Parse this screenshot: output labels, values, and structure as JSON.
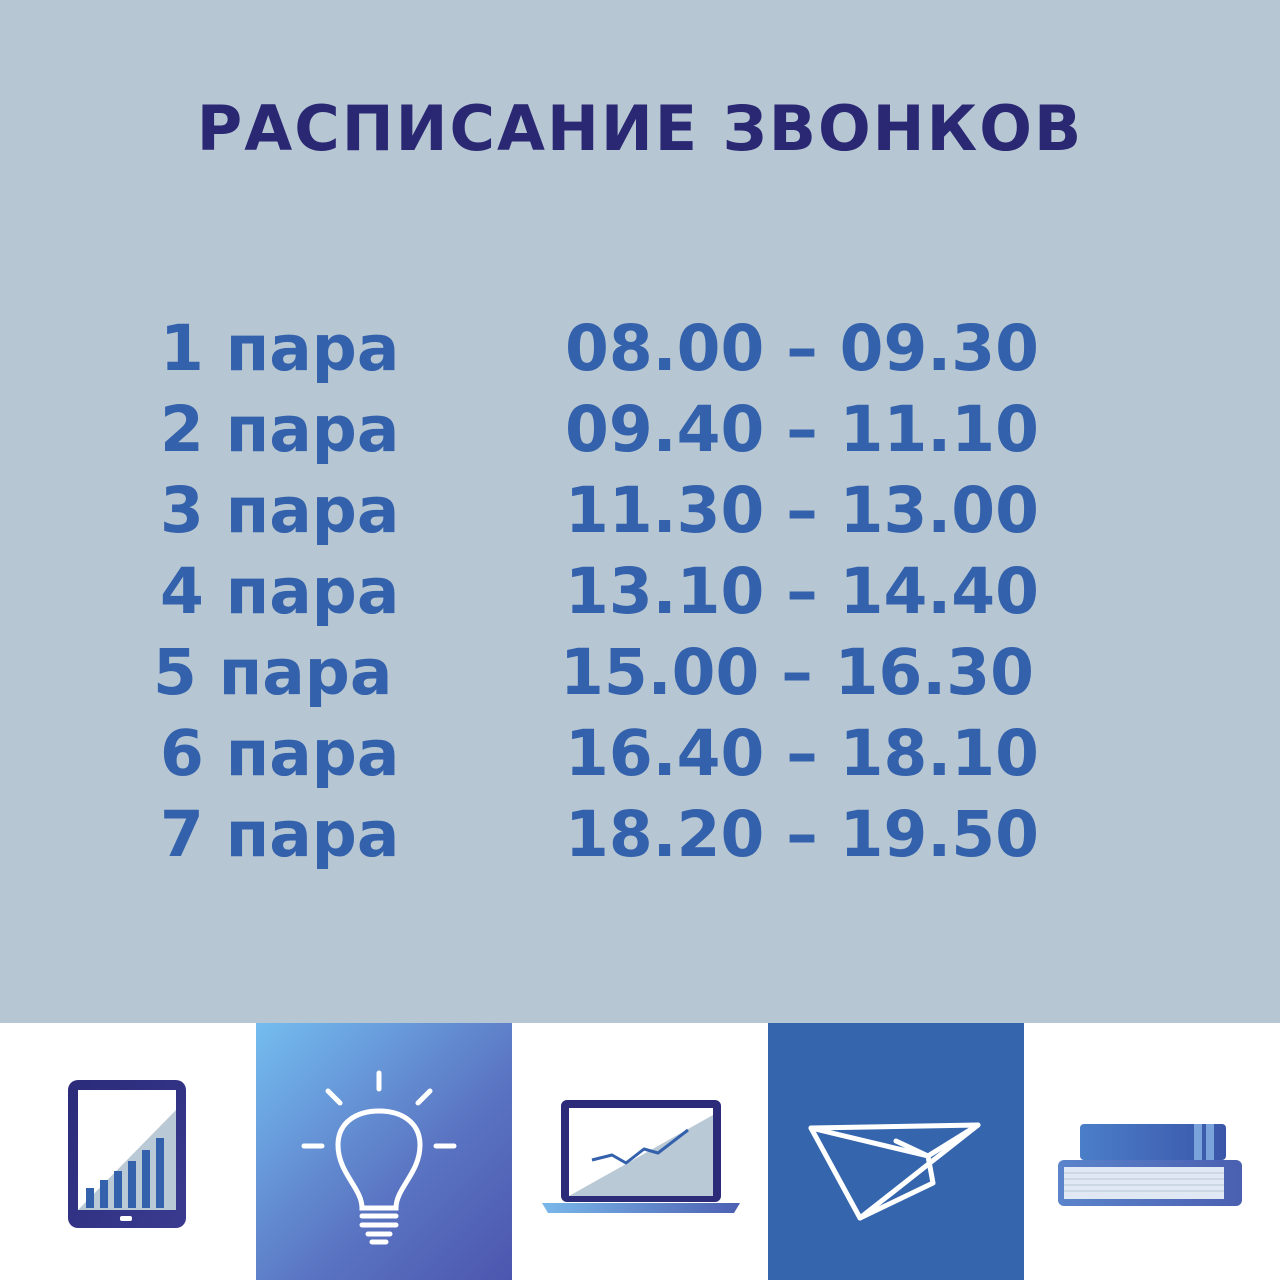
{
  "title": "РАСПИСАНИЕ ЗВОНКОВ",
  "schedule": [
    {
      "lesson": "1 пара",
      "time": "08.00 – 09.30"
    },
    {
      "lesson": "2 пара",
      "time": "09.40 – 11.10"
    },
    {
      "lesson": "3 пара",
      "time": "11.30 – 13.00"
    },
    {
      "lesson": "4 пара",
      "time": "13.10 – 14.40"
    },
    {
      "lesson": "5 пара",
      "time": "15.00 – 16.30"
    },
    {
      "lesson": "6 пара",
      "time": "16.40 – 18.10"
    },
    {
      "lesson": "7 пара",
      "time": "18.20 – 19.50"
    }
  ],
  "icons": [
    "tablet-chart-icon",
    "lightbulb-icon",
    "laptop-chart-icon",
    "paper-plane-icon",
    "books-icon"
  ],
  "colors": {
    "background": "#b6c7d3",
    "title": "#2a2773",
    "schedule_text": "#3461ab",
    "tile_blue": "#3566ad"
  }
}
